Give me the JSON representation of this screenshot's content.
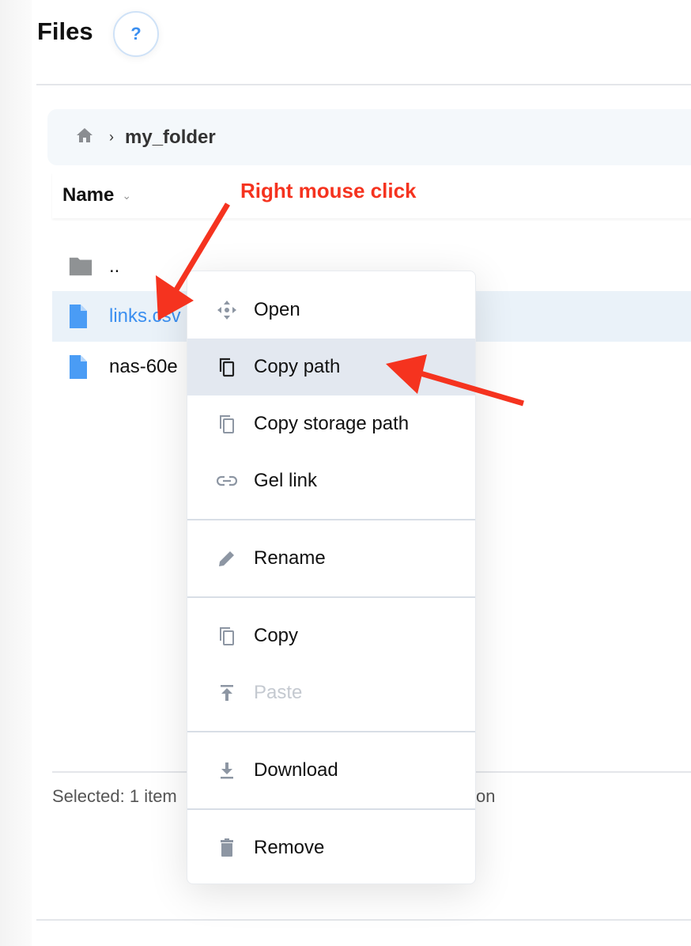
{
  "header": {
    "title": "Files",
    "help_label": "?"
  },
  "breadcrumb": {
    "home_icon": "home-icon",
    "separator": "›",
    "folder": "my_folder"
  },
  "table": {
    "column_name": "Name",
    "rows": [
      {
        "name": "..",
        "icon": "folder-icon",
        "selected": false
      },
      {
        "name": "links.csv",
        "icon": "file-icon",
        "selected": true
      },
      {
        "name": "nas-60e",
        "icon": "file-icon",
        "selected": false
      }
    ]
  },
  "status": {
    "text": "Selected: 1 item",
    "trailing": "on"
  },
  "context_menu": {
    "items": [
      {
        "label": "Open",
        "icon": "move-icon"
      },
      {
        "label": "Copy path",
        "icon": "copy-icon",
        "highlighted": true
      },
      {
        "label": "Copy storage path",
        "icon": "copy-icon"
      },
      {
        "label": "Gel link",
        "icon": "link-icon"
      },
      {
        "label": "Rename",
        "icon": "pencil-icon"
      },
      {
        "label": "Copy",
        "icon": "copy-icon"
      },
      {
        "label": "Paste",
        "icon": "paste-icon",
        "disabled": true
      },
      {
        "label": "Download",
        "icon": "download-icon"
      },
      {
        "label": "Remove",
        "icon": "trash-icon"
      }
    ]
  },
  "annotation": {
    "text": "Right mouse click",
    "color": "#f5331f"
  },
  "colors": {
    "accent": "#3b8ff0",
    "selected_row": "#eaf2f9",
    "menu_highlight": "#e3e8f0"
  }
}
